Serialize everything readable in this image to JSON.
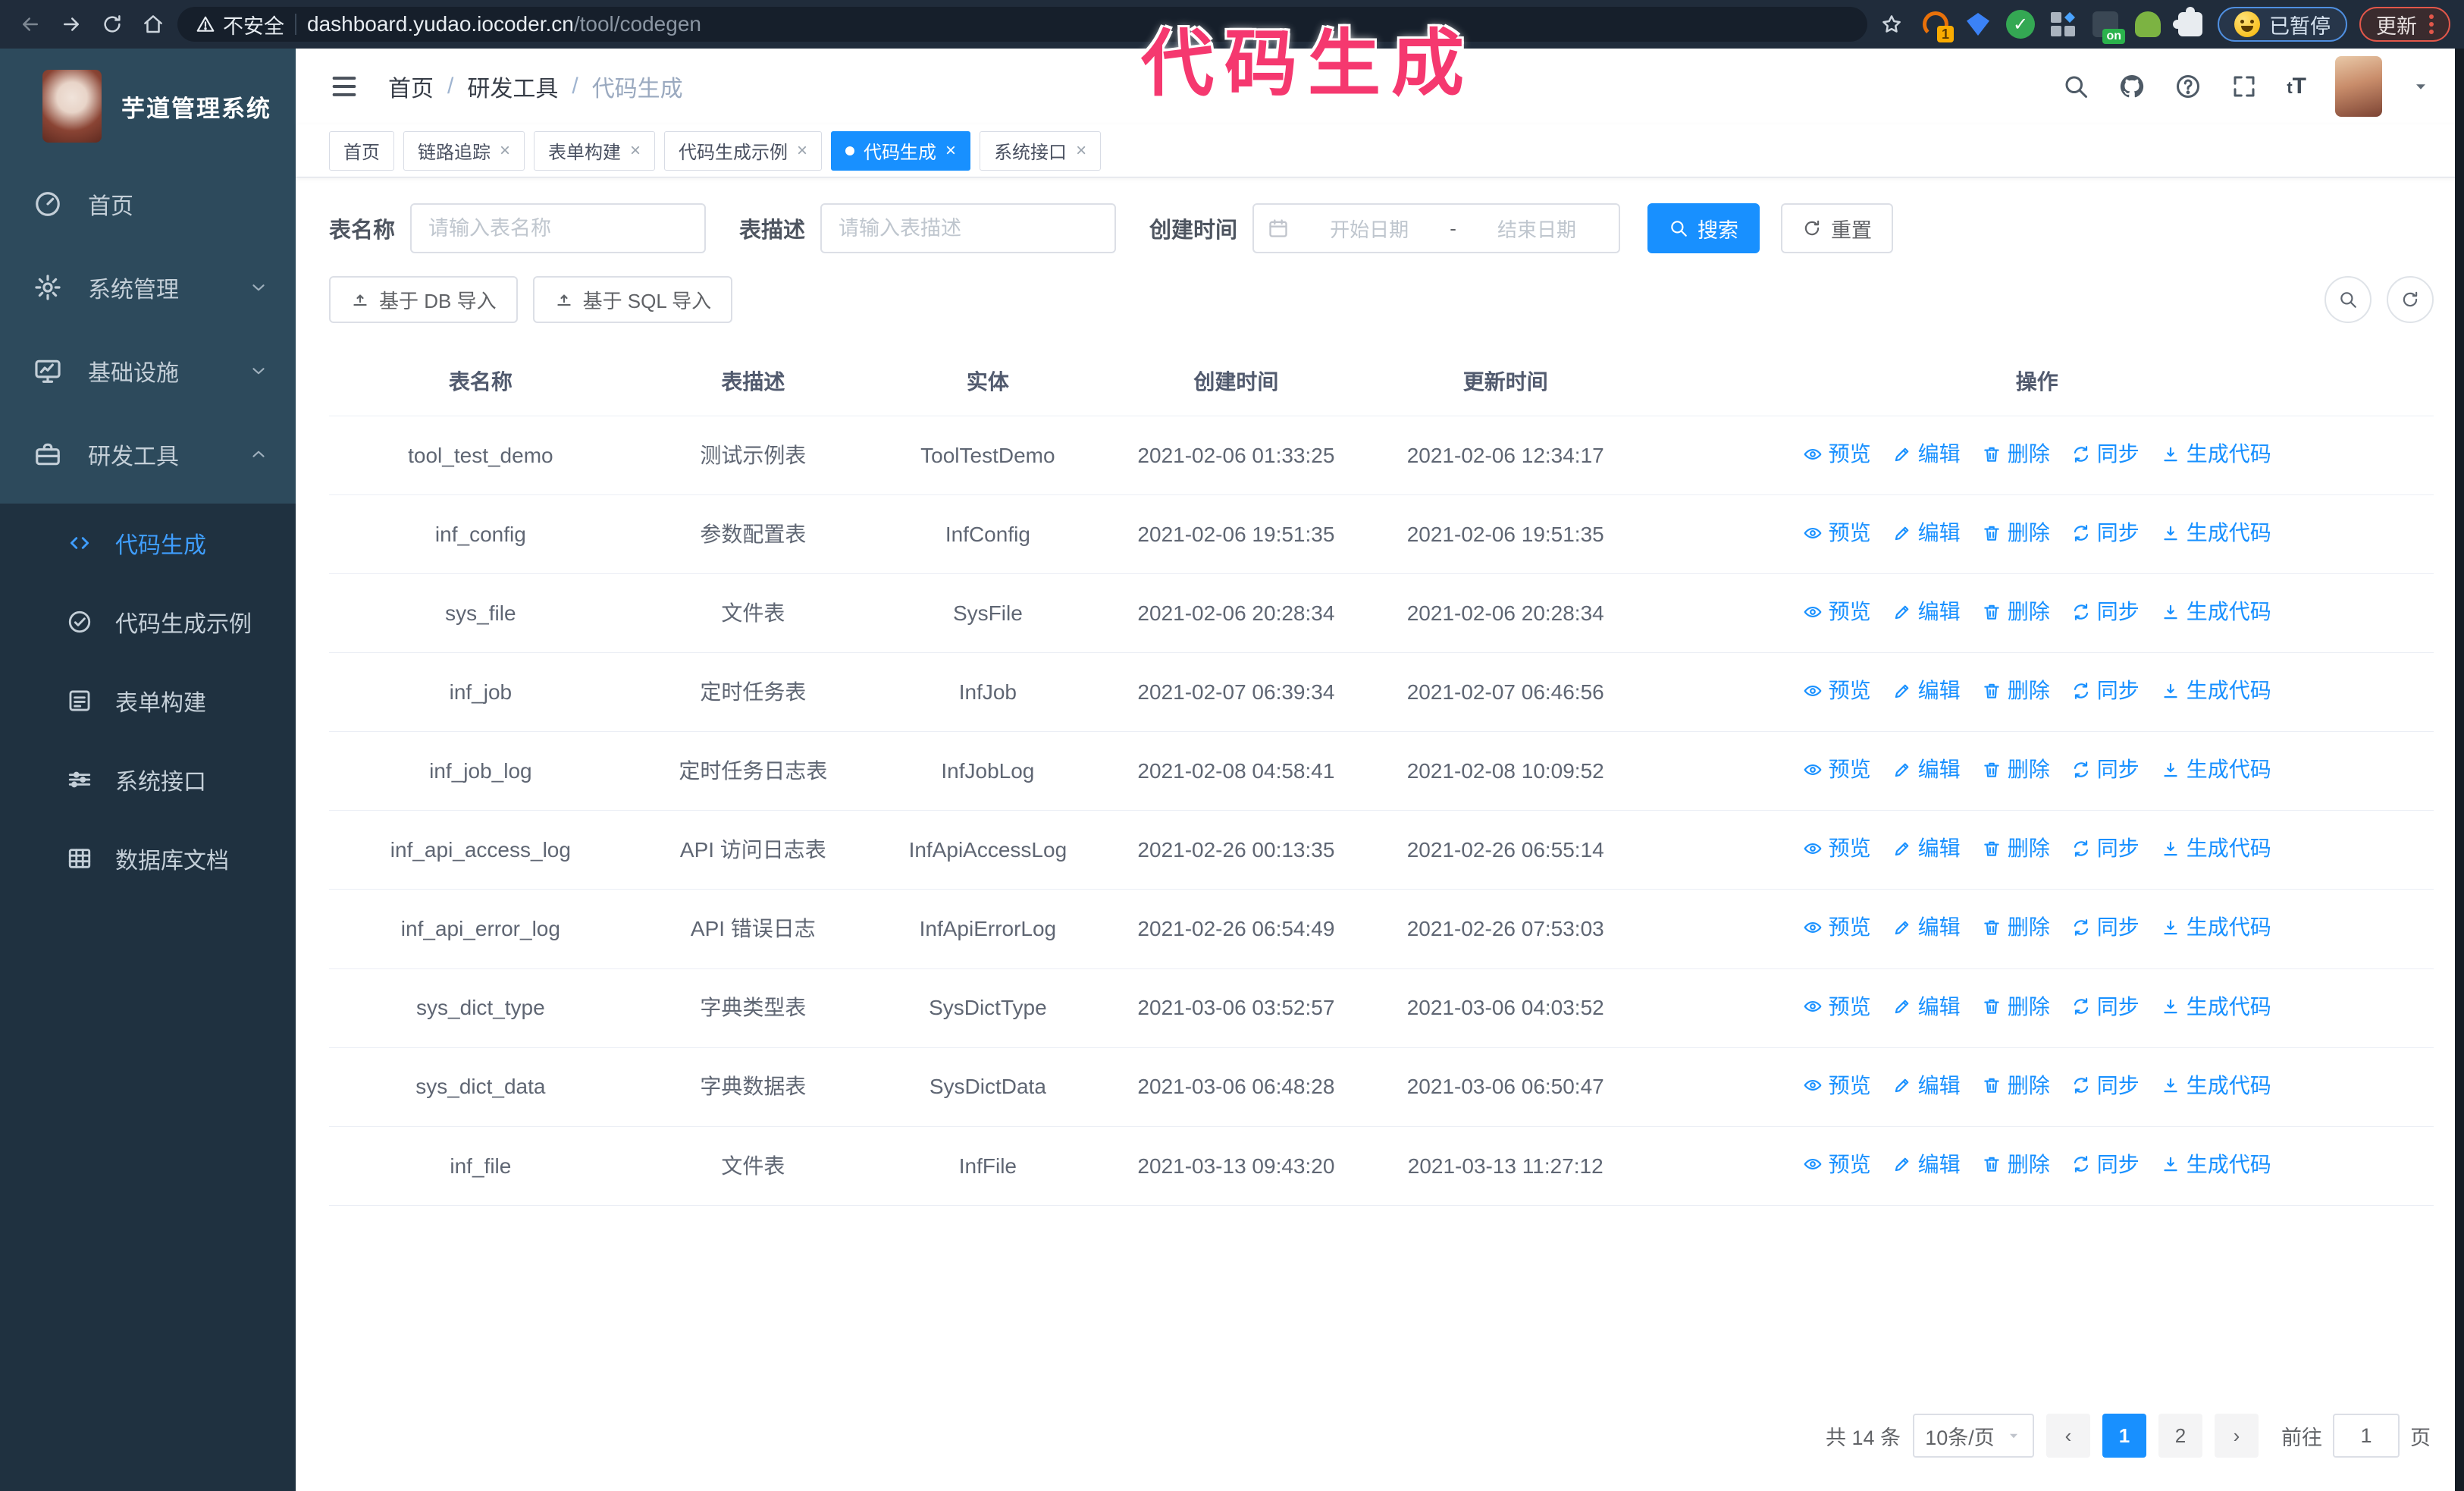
{
  "theme": {
    "primary": "#1890ff",
    "sidebar_active": "#3f9eff",
    "annotation_color": "#f5386f"
  },
  "annotation": {
    "text": "代码生成"
  },
  "browser": {
    "security_label": "不安全",
    "url_host": "dashboard.yudao.iocoder.cn",
    "url_path": "/tool/codegen",
    "extension_badge_1": "1",
    "extension_badge_on": "on",
    "paused_label": "已暂停",
    "update_label": "更新"
  },
  "sidebar": {
    "title": "芋道管理系统",
    "menu": [
      {
        "label": "首页",
        "icon": "gauge-icon",
        "expandable": false,
        "expanded": false
      },
      {
        "label": "系统管理",
        "icon": "gear-icon",
        "expandable": true,
        "expanded": false
      },
      {
        "label": "基础设施",
        "icon": "monitor-icon",
        "expandable": true,
        "expanded": false
      },
      {
        "label": "研发工具",
        "icon": "toolbox-icon",
        "expandable": true,
        "expanded": true
      }
    ],
    "submenu": [
      {
        "label": "代码生成",
        "icon": "code-icon",
        "active": true
      },
      {
        "label": "代码生成示例",
        "icon": "check-circle-icon",
        "active": false
      },
      {
        "label": "表单构建",
        "icon": "form-icon",
        "active": false
      },
      {
        "label": "系统接口",
        "icon": "sliders-icon",
        "active": false
      },
      {
        "label": "数据库文档",
        "icon": "table-icon",
        "active": false
      }
    ]
  },
  "navbar": {
    "breadcrumb": [
      {
        "label": "首页",
        "current": false
      },
      {
        "label": "研发工具",
        "current": false
      },
      {
        "label": "代码生成",
        "current": true
      }
    ]
  },
  "tabbar": {
    "tabs": [
      {
        "label": "首页",
        "closable": false,
        "active": false
      },
      {
        "label": "链路追踪",
        "closable": true,
        "active": false
      },
      {
        "label": "表单构建",
        "closable": true,
        "active": false
      },
      {
        "label": "代码生成示例",
        "closable": true,
        "active": false
      },
      {
        "label": "代码生成",
        "closable": true,
        "active": true
      },
      {
        "label": "系统接口",
        "closable": true,
        "active": false
      }
    ]
  },
  "filters": {
    "name_label": "表名称",
    "name_placeholder": "请输入表名称",
    "desc_label": "表描述",
    "desc_placeholder": "请输入表描述",
    "time_label": "创建时间",
    "start_placeholder": "开始日期",
    "range_separator": "-",
    "end_placeholder": "结束日期",
    "search_label": "搜索",
    "reset_label": "重置"
  },
  "toolbar": {
    "db_import_label": "基于 DB 导入",
    "sql_import_label": "基于 SQL 导入"
  },
  "table": {
    "columns": [
      "表名称",
      "表描述",
      "实体",
      "创建时间",
      "更新时间",
      "操作"
    ],
    "actions": [
      {
        "label": "预览",
        "icon": "eye-icon"
      },
      {
        "label": "编辑",
        "icon": "edit-icon"
      },
      {
        "label": "删除",
        "icon": "trash-icon"
      },
      {
        "label": "同步",
        "icon": "sync-icon"
      },
      {
        "label": "生成代码",
        "icon": "download-icon"
      }
    ],
    "rows": [
      {
        "name": "tool_test_demo",
        "description": "测试示例表",
        "entity": "ToolTestDemo",
        "create_time": "2021-02-06 01:33:25",
        "update_time": "2021-02-06 12:34:17"
      },
      {
        "name": "inf_config",
        "description": "参数配置表",
        "entity": "InfConfig",
        "create_time": "2021-02-06 19:51:35",
        "update_time": "2021-02-06 19:51:35"
      },
      {
        "name": "sys_file",
        "description": "文件表",
        "entity": "SysFile",
        "create_time": "2021-02-06 20:28:34",
        "update_time": "2021-02-06 20:28:34"
      },
      {
        "name": "inf_job",
        "description": "定时任务表",
        "entity": "InfJob",
        "create_time": "2021-02-07 06:39:34",
        "update_time": "2021-02-07 06:46:56"
      },
      {
        "name": "inf_job_log",
        "description": "定时任务日志表",
        "entity": "InfJobLog",
        "create_time": "2021-02-08 04:58:41",
        "update_time": "2021-02-08 10:09:52"
      },
      {
        "name": "inf_api_access_log",
        "description": "API 访问日志表",
        "entity": "InfApiAccessLog",
        "create_time": "2021-02-26 00:13:35",
        "update_time": "2021-02-26 06:55:14"
      },
      {
        "name": "inf_api_error_log",
        "description": "API 错误日志",
        "entity": "InfApiErrorLog",
        "create_time": "2021-02-26 06:54:49",
        "update_time": "2021-02-26 07:53:03"
      },
      {
        "name": "sys_dict_type",
        "description": "字典类型表",
        "entity": "SysDictType",
        "create_time": "2021-03-06 03:52:57",
        "update_time": "2021-03-06 04:03:52"
      },
      {
        "name": "sys_dict_data",
        "description": "字典数据表",
        "entity": "SysDictData",
        "create_time": "2021-03-06 06:48:28",
        "update_time": "2021-03-06 06:50:47"
      },
      {
        "name": "inf_file",
        "description": "文件表",
        "entity": "InfFile",
        "create_time": "2021-03-13 09:43:20",
        "update_time": "2021-03-13 11:27:12"
      }
    ]
  },
  "pagination": {
    "total": "共 14 条",
    "page_size": "10条/页",
    "pages": [
      "1",
      "2"
    ],
    "active_page": "1",
    "goto_label": "前往",
    "goto_value": "1",
    "goto_unit": "页"
  }
}
